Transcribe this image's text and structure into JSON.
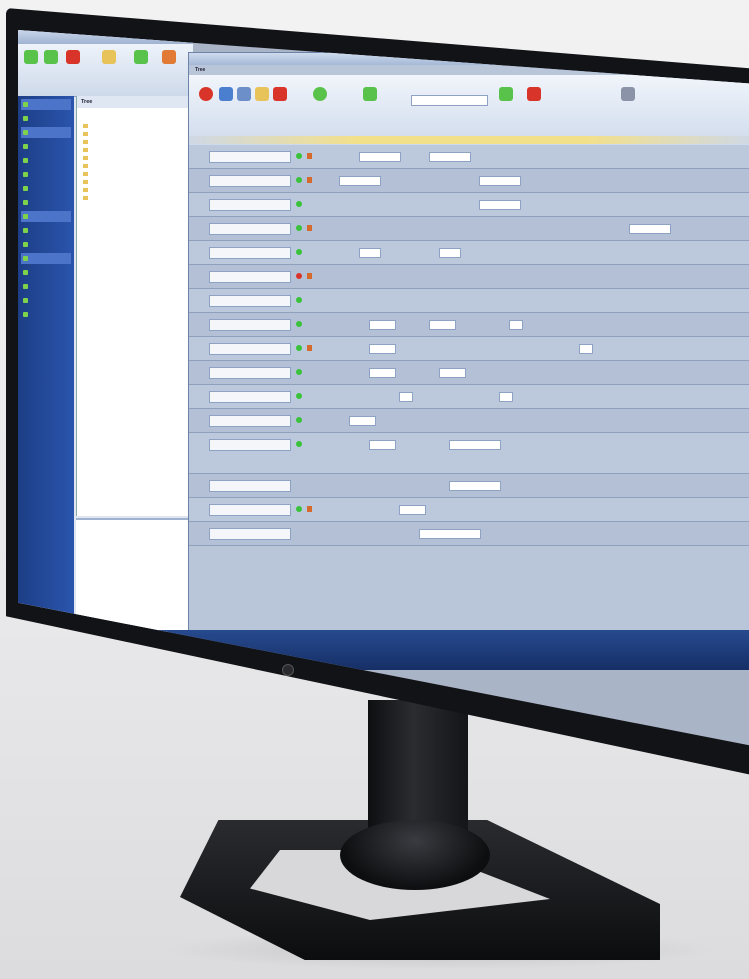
{
  "scene": {
    "description_kind": "monitor-on-stand"
  },
  "main_window": {
    "title": "",
    "pane_title": "Tree"
  },
  "left_window": {
    "title": "",
    "tree_header": "Tree"
  },
  "colors": {
    "nav_accent": "#2a55ad",
    "status_ok": "#39c23a",
    "status_error": "#d8342a",
    "highlight": "#f3e08a"
  }
}
